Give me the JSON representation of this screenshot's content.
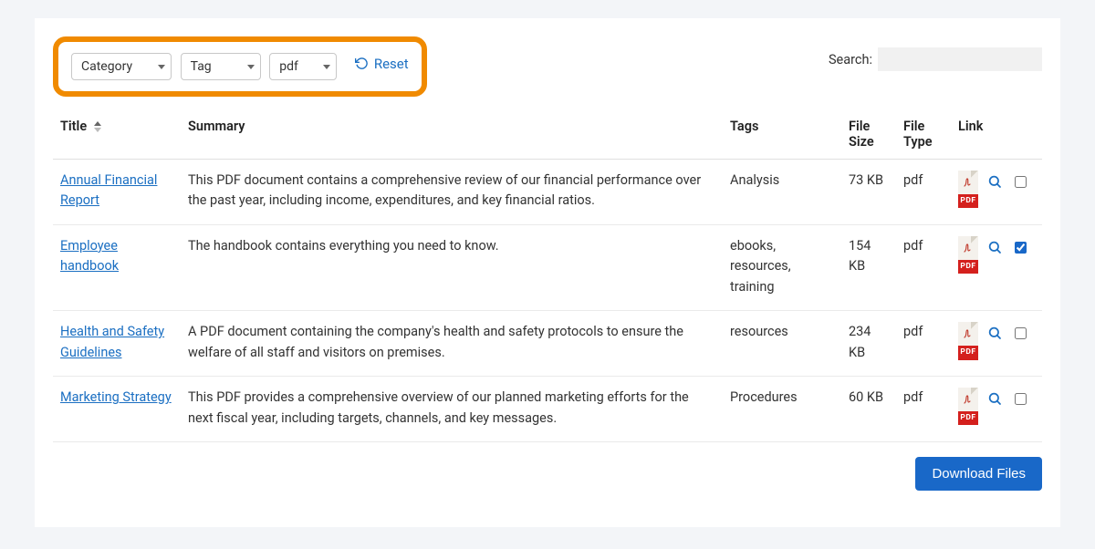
{
  "filters": {
    "category_label": "Category",
    "tag_label": "Tag",
    "filetype_value": "pdf",
    "reset_label": "Reset"
  },
  "search": {
    "label": "Search:",
    "value": ""
  },
  "columns": {
    "title": "Title",
    "summary": "Summary",
    "tags": "Tags",
    "file_size": "File Size",
    "file_type": "File Type",
    "link": "Link"
  },
  "pdf_badge": "PDF",
  "download_label": "Download Files",
  "rows": [
    {
      "title": "Annual Financial Report",
      "summary": "This PDF document contains a comprehensive review of our financial performance over the past year, including income, expenditures, and key financial ratios.",
      "tags": "Analysis",
      "size": "73 KB",
      "type": "pdf",
      "checked": false
    },
    {
      "title": "Employee handbook",
      "summary": "The handbook contains everything you need to know.",
      "tags": "ebooks, resources, training",
      "size": "154 KB",
      "type": "pdf",
      "checked": true
    },
    {
      "title": "Health and Safety Guidelines",
      "summary": "A PDF document containing the company's health and safety protocols to ensure the welfare of all staff and visitors on premises.",
      "tags": "resources",
      "size": "234 KB",
      "type": "pdf",
      "checked": false
    },
    {
      "title": "Marketing Strategy",
      "summary": "This PDF provides a comprehensive overview of our planned marketing efforts for the next fiscal year, including targets, channels, and key messages.",
      "tags": "Procedures",
      "size": "60 KB",
      "type": "pdf",
      "checked": false
    }
  ]
}
